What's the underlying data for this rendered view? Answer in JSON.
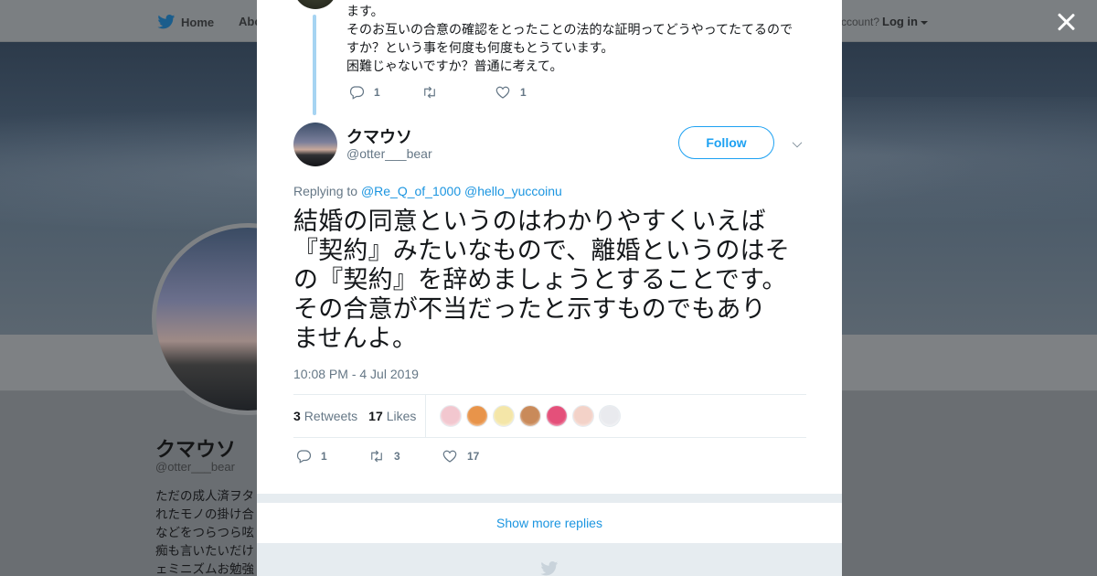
{
  "topbar": {
    "home_label": "Home",
    "about_label": "Abo",
    "account_prompt": "ccount?",
    "login_label": "Log in"
  },
  "profile": {
    "name": "クマウソ",
    "handle": "@otter___bear",
    "bio_lines": [
      "ただの成人済ヲタ",
      "れたモノの掛け合",
      "などをつらつら呟",
      "痴も言いたいだけ",
      "ェミニズムお勉強"
    ]
  },
  "parent_tweet": {
    "text_lines": [
      "ます。",
      "そのお互いの合意の確認をとったことの法的な証明ってどうやってたてるので",
      "すか？という事を何度も何度もとうています。",
      "困難じゃないですか？普通に考えて。"
    ],
    "reply_count": "1",
    "retweet_count": "",
    "like_count": "1"
  },
  "tweet": {
    "fullname": "クマウソ",
    "handle": "@otter___bear",
    "follow_label": "Follow",
    "replying_prefix": "Replying to",
    "replying_to": [
      "@Re_Q_of_1000",
      "@hello_yuccoinu"
    ],
    "text_lines": [
      "結婚の同意というのはわかりやすくいえば",
      "『契約』みたいなもので、離婚というのはそ",
      "の『契約』を辞めましょうとすることです。",
      "その合意が不当だったと示すものでもあり",
      "ませんよ。"
    ],
    "timestamp": "10:08 PM - 4 Jul 2019",
    "retweets_count": "3",
    "retweets_label": "Retweets",
    "likes_count": "17",
    "likes_label": "Likes",
    "reply_count": "1",
    "retweet_count": "3",
    "like_count": "17"
  },
  "likers": [
    "#f2c7cf",
    "#e8944a",
    "#f4e6a8",
    "#c98a5a",
    "#e4507a",
    "#f3d2c8",
    "#e9eaee"
  ],
  "show_more_label": "Show more replies"
}
